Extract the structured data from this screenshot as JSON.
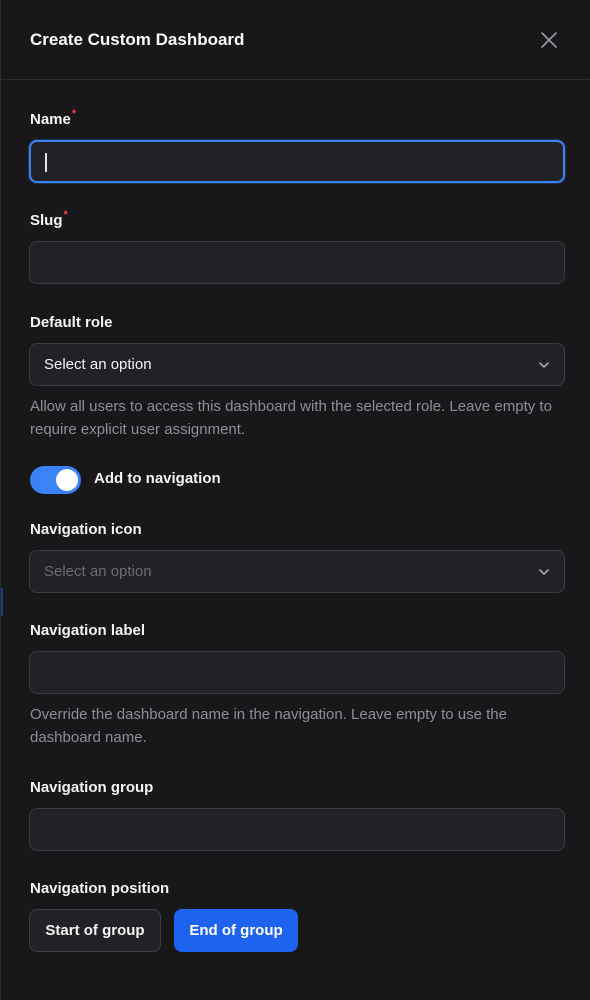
{
  "header": {
    "title": "Create Custom Dashboard"
  },
  "fields": {
    "name": {
      "label": "Name",
      "required_mark": "*",
      "value": ""
    },
    "slug": {
      "label": "Slug",
      "required_mark": "*",
      "value": ""
    },
    "default_role": {
      "label": "Default role",
      "selected": "Select an option",
      "help": "Allow all users to access this dashboard with the selected role. Leave empty to require explicit user assignment."
    },
    "add_to_navigation": {
      "label": "Add to navigation",
      "enabled": true
    },
    "navigation_icon": {
      "label": "Navigation icon",
      "placeholder": "Select an option"
    },
    "navigation_label": {
      "label": "Navigation label",
      "value": "",
      "help": "Override the dashboard name in the navigation. Leave empty to use the dashboard name."
    },
    "navigation_group": {
      "label": "Navigation group",
      "value": ""
    },
    "navigation_position": {
      "label": "Navigation position",
      "options": [
        "Start of group",
        "End of group"
      ],
      "selected": "End of group"
    }
  },
  "colors": {
    "accent": "#3b82f6",
    "primary_button": "#1d63ed",
    "background": "#18181b",
    "required": "#ef4444"
  }
}
